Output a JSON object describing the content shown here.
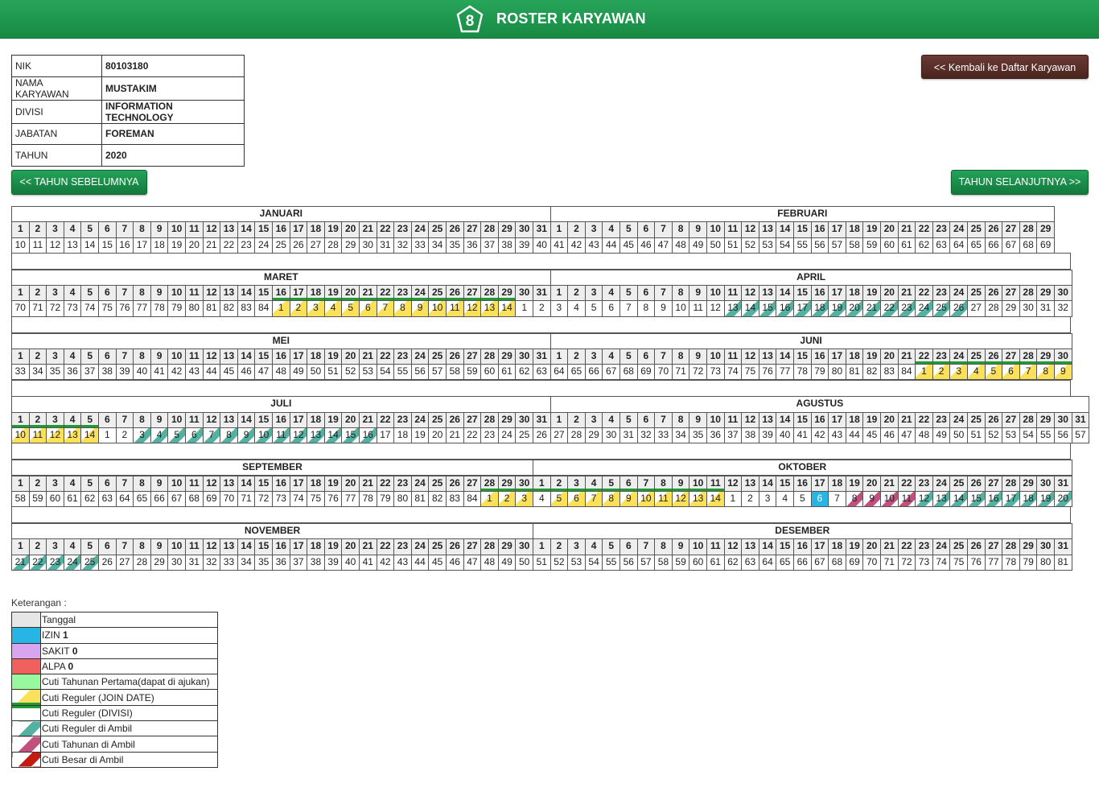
{
  "app": {
    "title": "ROSTER KARYAWAN",
    "logo_digit": "8"
  },
  "buttons": {
    "back": "<< Kembali ke Daftar Karyawan",
    "prev_year": "<< TAHUN SEBELUMNYA",
    "next_year": "TAHUN SELANJUTNYA >>"
  },
  "employee": [
    {
      "label": "NIK",
      "value": "80103180"
    },
    {
      "label": "NAMA KARYAWAN",
      "value": "MUSTAKIM"
    },
    {
      "label": "DIVISI",
      "value": "INFORMATION TECHNOLOGY"
    },
    {
      "label": "JABATAN",
      "value": "FOREMAN"
    },
    {
      "label": "TAHUN",
      "value": "2020"
    }
  ],
  "months": [
    {
      "name": "JANUARI",
      "days": 31,
      "counters": "10 11 12 13 14 15 16 17 18 19 20 21 22 23 24 25 26 27 28 29 30 31 32 33 34 35 36 37 38 39 40",
      "join": "",
      "divisi": "",
      "taken": "",
      "pink": "",
      "izin": ""
    },
    {
      "name": "FEBRUARI",
      "days": 29,
      "counters": "41 42 43 44 45 46 47 48 49 50 51 52 53 54 55 56 57 58 59 60 61 62 63 64 65 66 67 68 69",
      "join": "",
      "divisi": "",
      "taken": "",
      "pink": "",
      "izin": ""
    },
    {
      "name": "MARET",
      "days": 31,
      "counters": "70 71 72 73 74 75 76 77 78 79 80 81 82 83 84 1 2 3 4 5 6 7 8 9 10 11 12 13 14 1 2",
      "join": "16 17 18 19 20 21 22 23 24 25 26 27 28 29",
      "divisi": "16 17 18 19 20 21 22 23 24 25 26 27 28 29",
      "taken": "",
      "pink": "",
      "izin": ""
    },
    {
      "name": "APRIL",
      "days": 30,
      "counters": "3 4 5 6 7 8 9 10 11 12 13 14 15 16 17 18 19 20 21 22 23 24 25 26 27 28 29 30 31 32",
      "join": "",
      "divisi": "",
      "taken": "11 12 13 14 15 16 17 18 19 20 21 22 23 24",
      "pink": "",
      "izin": ""
    },
    {
      "name": "MEI",
      "days": 31,
      "counters": "33 34 35 36 37 38 39 40 41 42 43 44 45 46 47 48 49 50 51 52 53 54 55 56 57 58 59 60 61 62 63",
      "join": "",
      "divisi": "",
      "taken": "",
      "pink": "",
      "izin": ""
    },
    {
      "name": "JUNI",
      "days": 30,
      "counters": "64 65 66 67 68 69 70 71 72 73 74 75 76 77 78 79 80 81 82 83 84 1 2 3 4 5 6 7 8 9",
      "join": "22 23 24 25 26 27 28 29 30",
      "divisi": "22 23 24 25 26 27 28 29 30",
      "taken": "",
      "pink": "",
      "izin": ""
    },
    {
      "name": "JULI",
      "days": 31,
      "counters": "10 11 12 13 14 1 2 3 4 5 6 7 8 9 10 11 12 13 14 15 16 17 18 19 20 21 22 23 24 25 26",
      "join": "1 2 3 4 5",
      "divisi": "1 2 3 4 5",
      "taken": "8 9 10 11 12 13 14 15 16 17 18 19 20 21",
      "pink": "",
      "izin": ""
    },
    {
      "name": "AGUSTUS",
      "days": 31,
      "counters": "27 28 29 30 31 32 33 34 35 36 37 38 39 40 41 42 43 44 45 46 47 48 49 50 51 52 53 54 55 56 57",
      "join": "",
      "divisi": "",
      "taken": "",
      "pink": "",
      "izin": ""
    },
    {
      "name": "SEPTEMBER",
      "days": 30,
      "counters": "58 59 60 61 62 63 64 65 66 67 68 69 70 71 72 73 74 75 76 77 78 79 80 81 82 83 84 1 2 3",
      "join": "28 29 30",
      "divisi": "28 29 30",
      "taken": "",
      "pink": "",
      "izin": ""
    },
    {
      "name": "OKTOBER",
      "days": 31,
      "counters": "4 5 6 7 8 9 10 11 12 13 14 1 2 3 4 5 6 7 8 9 10 11 12 13 14 15 16 17 18 19 20",
      "join": "2 3 4 5 6 7 8 9 10 11",
      "divisi": "1 2 3 4 5 6 7 8 9 10 11",
      "taken": "23 24 25 26 27 28 29 30 31",
      "pink": "19 20 21 22",
      "izin": "17"
    },
    {
      "name": "NOVEMBER",
      "days": 30,
      "counters": "21 22 23 24 25 26 27 28 29 30 31 32 33 34 35 36 37 38 39 40 41 42 43 44 45 46 47 48 49 50",
      "join": "",
      "divisi": "",
      "taken": "1 2 3 4 5",
      "pink": "",
      "izin": ""
    },
    {
      "name": "DESEMBER",
      "days": 31,
      "counters": "51 52 53 54 55 56 57 58 59 60 61 62 63 64 65 66 67 68 69 70 71 72 73 74 75 76 77 78 79 80 81",
      "join": "",
      "divisi": "",
      "taken": "",
      "pink": "",
      "izin": ""
    }
  ],
  "legend": {
    "title": "Keterangan :",
    "items": [
      {
        "key": "tanggal",
        "label": "Tanggal",
        "count": "",
        "color": "#e6e6e6",
        "icon": "swatch-date"
      },
      {
        "key": "izin",
        "label": "IZIN",
        "count": "1",
        "color": "#27b5e6",
        "icon": "swatch-izin"
      },
      {
        "key": "sakit",
        "label": "SAKIT",
        "count": "0",
        "color": "#d9a5ef",
        "icon": "swatch-sakit"
      },
      {
        "key": "alpa",
        "label": "ALPA",
        "count": "0",
        "color": "#f0605c",
        "icon": "swatch-alpa"
      },
      {
        "key": "tahunan-pertama",
        "label": "Cuti Tahunan Pertama(dapat di ajukan)",
        "count": "",
        "color": "#97f89e",
        "icon": "swatch-annual-first"
      },
      {
        "key": "reguler-join",
        "label": "Cuti Reguler (JOIN DATE)",
        "count": "",
        "color": "#fbe05a",
        "icon": "swatch-join"
      },
      {
        "key": "reguler-divisi",
        "label": "Cuti Reguler (DIVISI)",
        "count": "",
        "color": "#1f9a35",
        "icon": "swatch-divisi"
      },
      {
        "key": "reguler-ambil",
        "label": "Cuti Reguler di Ambil",
        "count": "",
        "color": "#53b1a1",
        "icon": "swatch-taken"
      },
      {
        "key": "tahunan-ambil",
        "label": "Cuti Tahunan di Ambil",
        "count": "",
        "color": "#c24f7e",
        "icon": "swatch-annual-taken"
      },
      {
        "key": "besar-ambil",
        "label": "Cuti Besar di Ambil",
        "count": "",
        "color": "#c51a12",
        "icon": "swatch-big-taken"
      }
    ]
  }
}
